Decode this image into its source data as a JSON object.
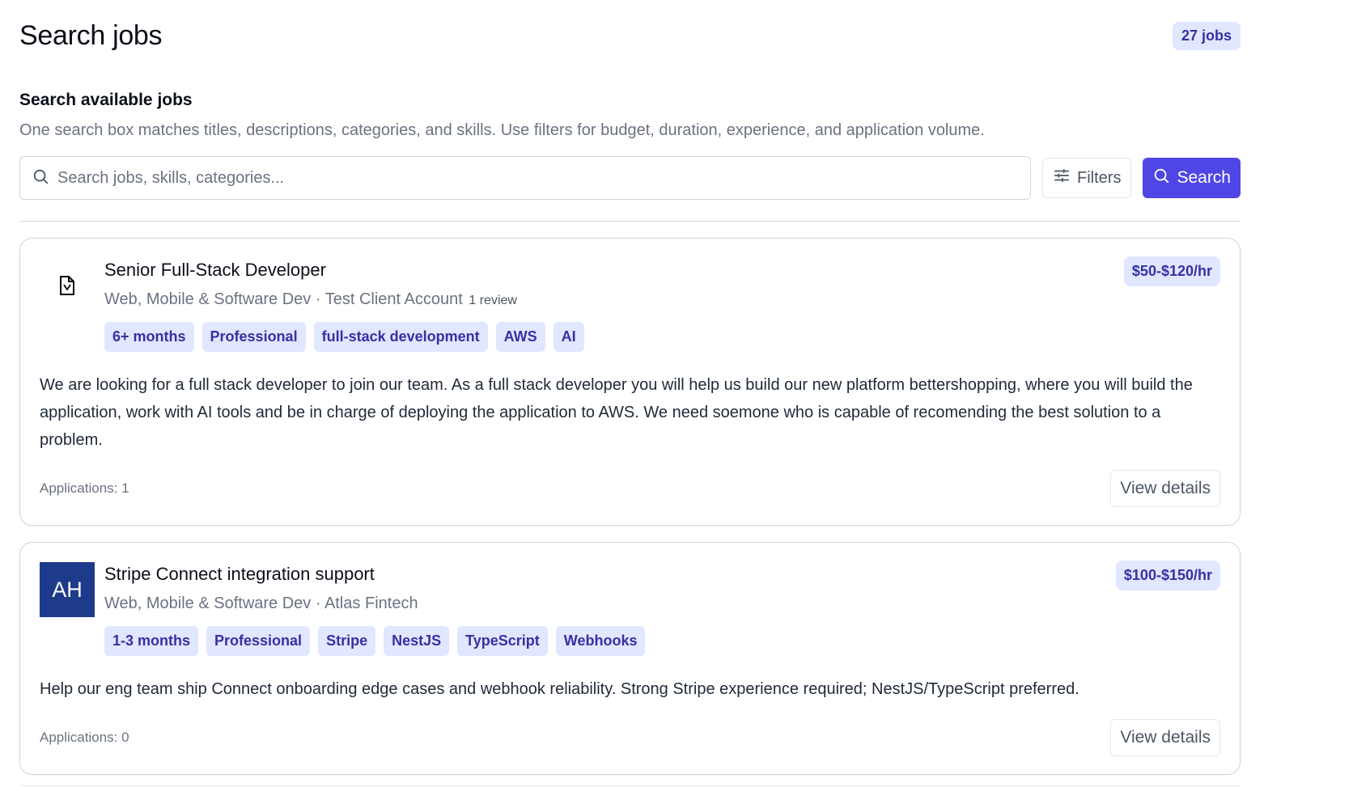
{
  "header": {
    "title": "Search jobs",
    "count_badge": "27 jobs"
  },
  "search_section": {
    "title": "Search available jobs",
    "description": "One search box matches titles, descriptions, categories, and skills. Use filters for budget, duration, experience, and application volume.",
    "input_placeholder": "Search jobs, skills, categories...",
    "input_value": "",
    "filters_label": "Filters",
    "search_label": "Search"
  },
  "jobs": [
    {
      "title": "Senior Full-Stack Developer",
      "category": "Web, Mobile & Software Dev",
      "separator": " · ",
      "client": "Test Client Account",
      "reviews": "1 review",
      "rate": "$50-$120/hr",
      "logo": "document-logo-icon",
      "tags": [
        "6+ months",
        "Professional",
        "full-stack development",
        "AWS",
        "AI"
      ],
      "description": "We are looking for a full stack developer to join our team. As a full stack developer you will help us build our new platform bettershopping, where you will build the application, work with AI tools and be in charge of deploying the application to AWS. We need soemone who is capable of recomending the best solution to a problem.",
      "applications": "Applications: 1",
      "view_label": "View details"
    },
    {
      "title": "Stripe Connect integration support",
      "category": "Web, Mobile & Software Dev",
      "separator": " · ",
      "client": "Atlas Fintech",
      "rate": "$100-$150/hr",
      "logo_initials": "AH",
      "logo_color": "#1e3a8a",
      "tags": [
        "1-3 months",
        "Professional",
        "Stripe",
        "NestJS",
        "TypeScript",
        "Webhooks"
      ],
      "description": "Help our eng team ship Connect onboarding edge cases and webhook reliability. Strong Stripe experience required; NestJS/TypeScript preferred.",
      "applications": "Applications: 0",
      "view_label": "View details"
    }
  ],
  "colors": {
    "accent": "#4f46e5",
    "badge_bg": "#e0e7ff",
    "badge_text": "#3730a3"
  }
}
